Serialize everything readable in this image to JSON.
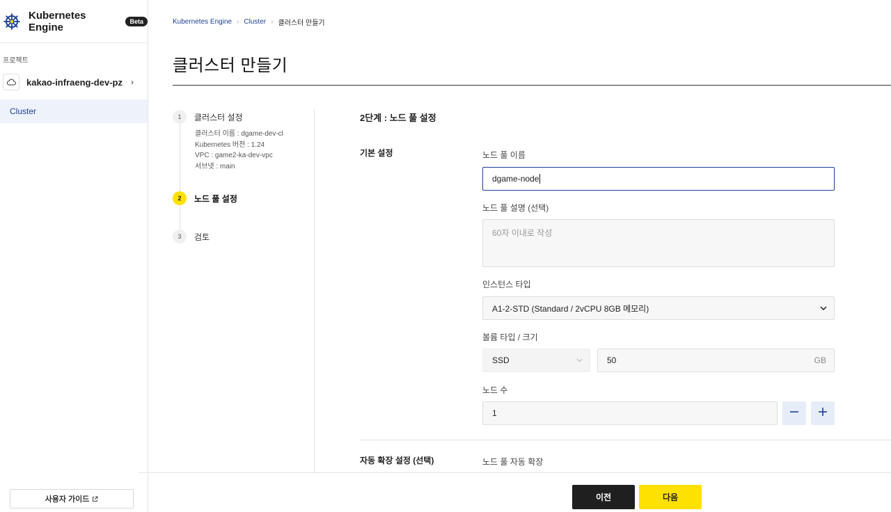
{
  "sidebar": {
    "brand_name": "Kubernetes Engine",
    "beta_badge": "Beta",
    "project_section_label": "프로젝트",
    "project_name": "kakao-infraeng-dev-pz",
    "nav_cluster": "Cluster",
    "user_guide": "사용자 가이드"
  },
  "breadcrumb": {
    "items": [
      "Kubernetes Engine",
      "Cluster",
      "클러스터 만들기"
    ]
  },
  "page": {
    "title": "클러스터 만들기"
  },
  "steps": [
    {
      "number": "1",
      "label": "클러스터 설정",
      "summary": [
        "클러스터 이름 : dgame-dev-cl",
        "Kubernetes 버전 : 1.24",
        "VPC : game2-ka-dev-vpc",
        "서브넷 : main"
      ]
    },
    {
      "number": "2",
      "label": "노드 풀 설정",
      "active": true
    },
    {
      "number": "3",
      "label": "검토"
    }
  ],
  "form": {
    "section_title": "2단계 : 노드 풀 설정",
    "basic_group": "기본 설정",
    "autoscale_group": "자동 확장 설정 (선택)",
    "node_pool_name": {
      "label": "노드 풀 이름",
      "value": "dgame-node"
    },
    "node_pool_desc": {
      "label": "노드 풀 설명 (선택)",
      "placeholder": "60자 이내로 작성"
    },
    "instance_type": {
      "label": "인스턴스 타입",
      "value": "A1-2-STD (Standard / 2vCPU 8GB 메모리)"
    },
    "volume": {
      "label": "볼륨 타입 / 크기",
      "type": "SSD",
      "size": "50",
      "unit": "GB"
    },
    "node_count": {
      "label": "노드 수",
      "value": "1"
    },
    "autoscale_label": "노드 풀 자동 확장"
  },
  "footer": {
    "prev": "이전",
    "next": "다음"
  },
  "colors": {
    "accent_yellow": "#ffe100",
    "link_blue": "#1c3f95",
    "dark_button": "#1f1f1f"
  }
}
